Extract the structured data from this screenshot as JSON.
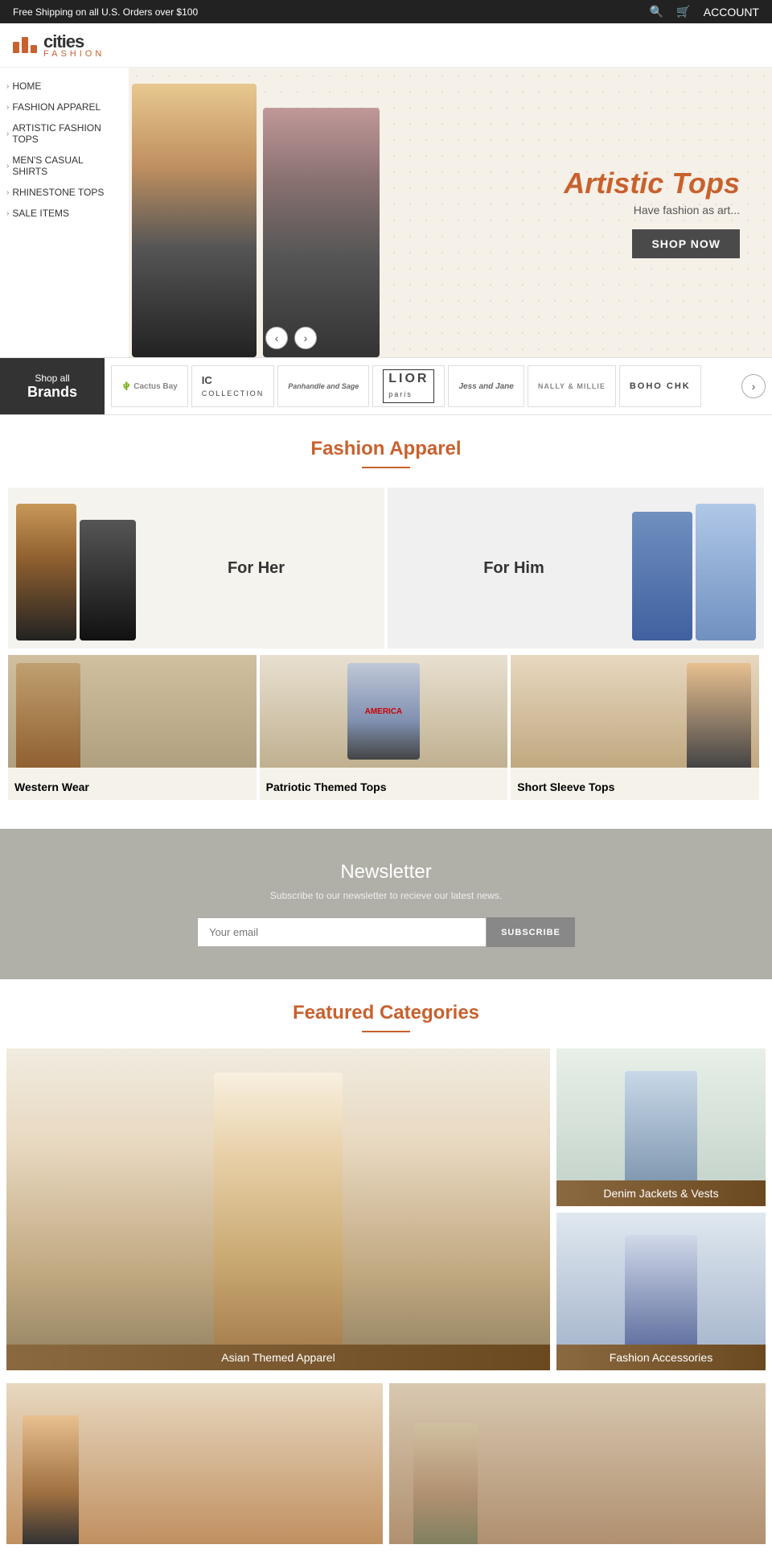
{
  "topbar": {
    "shipping_text": "Free Shipping on all U.S. Orders over $100",
    "account_label": "ACCOUNT"
  },
  "logo": {
    "name_main": "cities",
    "name_sub": "FASHION"
  },
  "nav": {
    "items": [
      {
        "label": "HOME",
        "id": "home"
      },
      {
        "label": "FASHION APPAREL",
        "id": "fashion-apparel"
      },
      {
        "label": "ARTISTIC FASHION TOPS",
        "id": "artistic-fashion-tops"
      },
      {
        "label": "MEN'S CASUAL SHIRTS",
        "id": "mens-casual-shirts"
      },
      {
        "label": "RHINESTONE TOPS",
        "id": "rhinestone-tops"
      },
      {
        "label": "SALE ITEMS",
        "id": "sale-items"
      }
    ]
  },
  "hero": {
    "title": "Artistic Tops",
    "subtitle": "Have fashion as art...",
    "cta": "SHOP NOW"
  },
  "brands": {
    "shop_all_line1": "Shop all",
    "shop_all_line2": "Brands",
    "items": [
      {
        "name": "Cactus Bay",
        "style": "cactus"
      },
      {
        "name": "IC Collection",
        "style": "ic"
      },
      {
        "name": "Panhandle and Sage",
        "style": "panhandle"
      },
      {
        "name": "LIOR paris",
        "style": "lior"
      },
      {
        "name": "Jess and Jane",
        "style": "jess"
      },
      {
        "name": "Nally & Millie",
        "style": "nally"
      },
      {
        "name": "Boho Chic",
        "style": "boho"
      }
    ]
  },
  "fashion_apparel": {
    "section_title": "Fashion Apparel",
    "categories": [
      {
        "label": "For Her",
        "id": "for-her"
      },
      {
        "label": "For Him",
        "id": "for-him"
      },
      {
        "label": "Western Wear",
        "id": "western-wear"
      },
      {
        "label": "Patriotic Themed Tops",
        "id": "patriotic"
      },
      {
        "label": "Short Sleeve Tops",
        "id": "short-sleeve"
      }
    ]
  },
  "newsletter": {
    "title": "Newsletter",
    "subtitle": "Subscribe to our newsletter to recieve our latest news.",
    "input_placeholder": "Your email",
    "button_label": "SUBSCRIBE"
  },
  "featured": {
    "section_title": "Featured Categories",
    "categories": [
      {
        "label": "Asian Themed Apparel",
        "id": "asian-themed"
      },
      {
        "label": "Denim Jackets & Vests",
        "id": "denim-jackets"
      },
      {
        "label": "Fashion Accessories",
        "id": "fashion-accessories"
      }
    ]
  }
}
